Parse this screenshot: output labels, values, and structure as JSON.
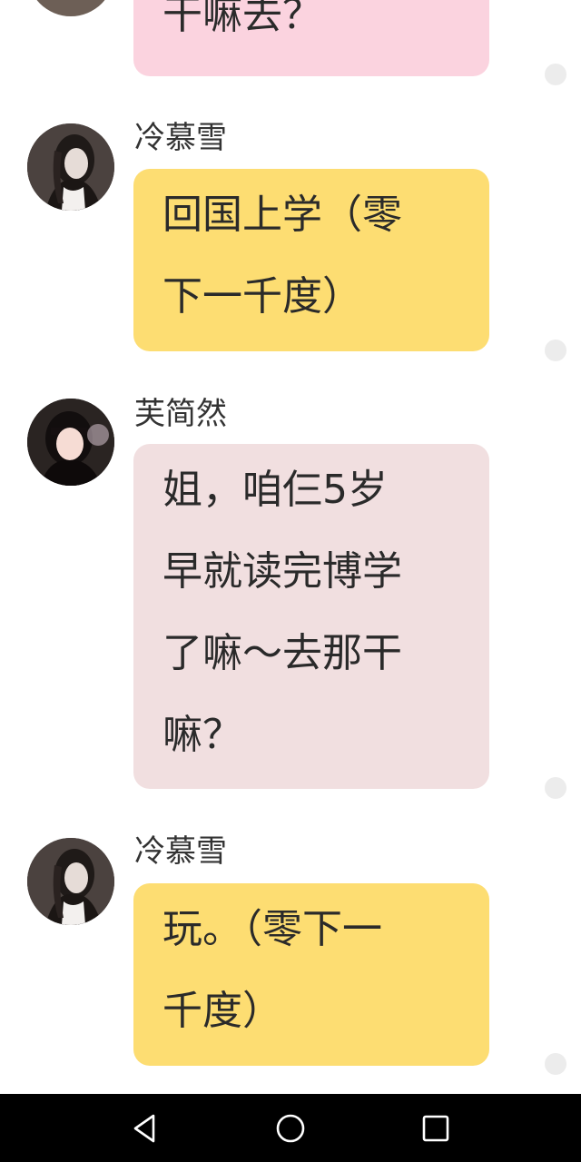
{
  "messages": [
    {
      "sender": "",
      "lines": [
        "干嘛去？"
      ],
      "color": "#fbd3df"
    },
    {
      "sender": "冷慕雪",
      "lines": [
        "回国上学（零",
        "下一千度）"
      ],
      "color": "#fddd72"
    },
    {
      "sender": "芙简然",
      "lines": [
        "姐，咱仨5岁",
        "早就读完博学",
        "了嘛～去那干",
        "嘛？"
      ],
      "color": "#f1dfe0"
    },
    {
      "sender": "冷慕雪",
      "lines": [
        "玩。（零下一",
        "千度）"
      ],
      "color": "#fddd72"
    }
  ],
  "navbar": {
    "back_icon": "back-triangle-icon",
    "home_icon": "home-circle-icon",
    "recents_icon": "recents-square-icon"
  }
}
